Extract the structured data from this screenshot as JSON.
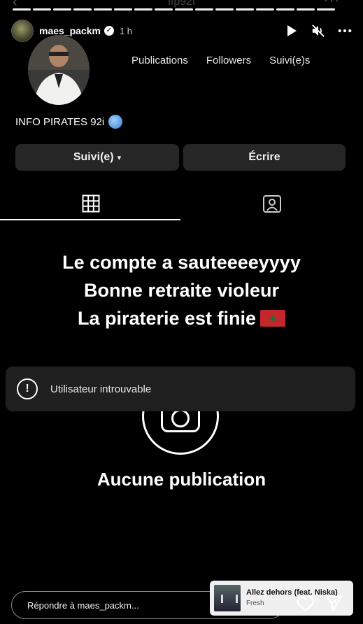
{
  "top": {
    "ghost_title": "ifp92i",
    "progress_segments": 16
  },
  "story": {
    "username": "maes_packm",
    "time": "1 h",
    "verified": true
  },
  "profile": {
    "stats": [
      "Publications",
      "Followers",
      "Suivi(e)s"
    ],
    "name": "INFO PIRATES 92i",
    "follow_button": "Suivi(e)",
    "write_button": "Écrire"
  },
  "overlay": {
    "line1": "Le compte a sauteeeeyyyy",
    "line2": "Bonne retraite violeur",
    "line3": "La piraterie est finie"
  },
  "empty_state": {
    "label": "Aucune publication"
  },
  "toast": {
    "text": "Utilisateur introuvable"
  },
  "bottom": {
    "reply_placeholder": "Répondre à maes_packm...",
    "music_title": "Allez dehors (feat. Niska)",
    "music_artist": "Fresh"
  },
  "colors": {
    "background": "#000000",
    "button_bg": "#262626",
    "flag_red": "#c1272d",
    "flag_green": "#0b7a3b"
  }
}
